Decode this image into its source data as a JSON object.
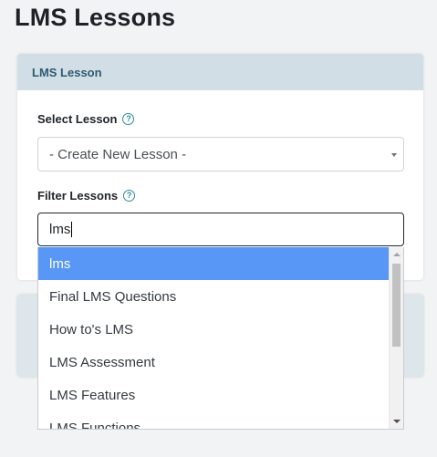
{
  "page": {
    "title": "LMS Lessons"
  },
  "card": {
    "header": "LMS Lesson",
    "select_lesson": {
      "label": "Select Lesson",
      "value": "- Create New Lesson -"
    },
    "filter_lessons": {
      "label": "Filter Lessons",
      "value": "lms"
    }
  },
  "icons": {
    "help": "question-circle-icon",
    "select_caret": "caret-down-icon",
    "scroll_up": "arrow-up-icon",
    "scroll_down": "arrow-down-icon"
  },
  "colors": {
    "active_item": "#5897f5",
    "card_header_bg": "#d1dee5",
    "help_icon": "#2a8d9a"
  },
  "dropdown": {
    "items": [
      {
        "label": "lms"
      },
      {
        "label": "Final LMS Questions"
      },
      {
        "label": "How to's LMS"
      },
      {
        "label": "LMS Assessment"
      },
      {
        "label": "LMS Features"
      },
      {
        "label": "LMS Functions"
      }
    ]
  }
}
